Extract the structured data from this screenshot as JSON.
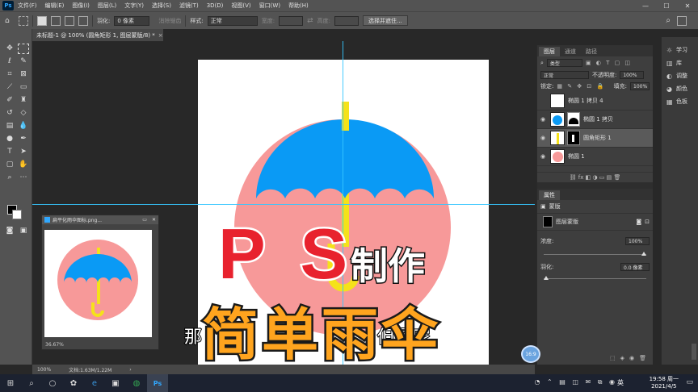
{
  "menubar": {
    "logo": "Ps",
    "items": [
      "文件(F)",
      "编辑(E)",
      "图像(I)",
      "图层(L)",
      "文字(Y)",
      "选择(S)",
      "滤镜(T)",
      "3D(D)",
      "视图(V)",
      "窗口(W)",
      "帮助(H)"
    ],
    "min": "—",
    "max": "☐",
    "close": "✕"
  },
  "options": {
    "feather_label": "羽化:",
    "feather_value": "0 像素",
    "antialias": "消除锯齿",
    "style_label": "样式:",
    "style_value": "正常",
    "width_label": "宽度:",
    "height_label": "高度:",
    "select_mask": "选择并遮住..."
  },
  "document": {
    "tab_title": "未标题-1 @ 100% (圆角矩形 1, 图层蒙版/8) *",
    "tab_close": "×",
    "status_zoom": "100%",
    "status_doc": "文档:1.63M/1.22M"
  },
  "subwindow": {
    "title": "扁平化雨伞图标.png...",
    "zoom": "36.67%"
  },
  "layers_panel": {
    "tabs": [
      "图层",
      "通道",
      "路径"
    ],
    "kind": "类型",
    "blend": "正常",
    "opacity_label": "不透明度:",
    "opacity_value": "100%",
    "lock_label": "锁定:",
    "fill_label": "填充:",
    "fill_value": "100%",
    "layers": [
      {
        "name": "椭圆 1 拷贝 4",
        "visible": false
      },
      {
        "name": "椭圆 1 拷贝",
        "visible": true
      },
      {
        "name": "圆角矩形 1",
        "visible": true
      },
      {
        "name": "椭圆 1",
        "visible": true
      },
      {
        "name": "",
        "visible": false
      }
    ],
    "footer": "⛓  fx  ◧  ◑  ▭  ▤  🗑"
  },
  "properties_panel": {
    "title": "属性",
    "section": "蒙版",
    "mask_label": "图层蒙版",
    "density_label": "浓度:",
    "density_value": "100%",
    "feather_label": "羽化:",
    "feather_value": "0.0 像素"
  },
  "mini_panels": [
    "学习",
    "库",
    "调整",
    "颜色",
    "色板"
  ],
  "overlay": {
    "ps": "P S",
    "make": "制作",
    "title": "简单雨伞",
    "subtitle": "那                               但是呢",
    "badge": "16:9"
  },
  "taskbar": {
    "time": "19:58 周一",
    "date": "2021/4/5",
    "ime": "英"
  },
  "colors": {
    "umbrella_blue": "#0a9af5",
    "circle_pink": "#f79999",
    "handle_yellow": "#f5e21a",
    "guide": "#35c7ff"
  }
}
